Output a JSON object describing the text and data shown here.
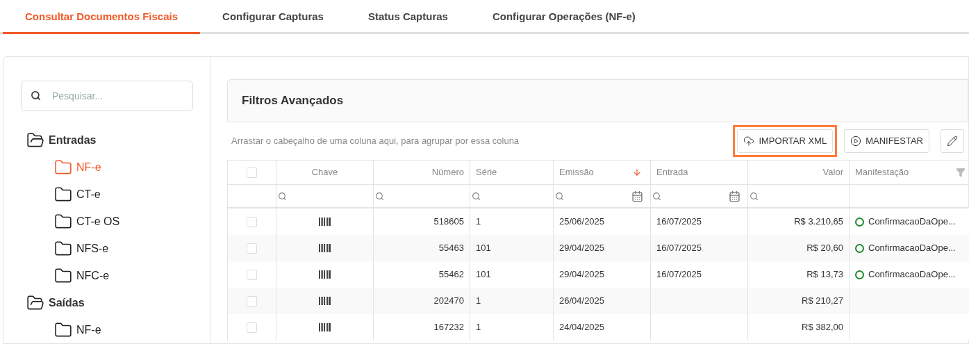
{
  "tabs": [
    {
      "label": "Consultar Documentos Fiscais",
      "selected": true
    },
    {
      "label": "Configurar Capturas",
      "selected": false
    },
    {
      "label": "Status Capturas",
      "selected": false
    },
    {
      "label": "Configurar Operações (NF-e)",
      "selected": false
    }
  ],
  "sidebar": {
    "search": {
      "placeholder": "Pesquisar..."
    },
    "tree": [
      {
        "label": "Entradas",
        "expanded": true,
        "children": [
          {
            "label": "NF-e",
            "selected": true
          },
          {
            "label": "CT-e",
            "selected": false
          },
          {
            "label": "CT-e OS",
            "selected": false
          },
          {
            "label": "NFS-e",
            "selected": false
          },
          {
            "label": "NFC-e",
            "selected": false
          }
        ]
      },
      {
        "label": "Saídas",
        "expanded": true,
        "children": [
          {
            "label": "NF-e",
            "selected": false
          }
        ]
      }
    ]
  },
  "filters_panel": {
    "title": "Filtros Avançados"
  },
  "group_hint": "Arrastar o cabeçalho de uma coluna aqui, para agrupar por essa coluna",
  "toolbar": [
    {
      "kind": "upload",
      "label": "IMPORTAR XML",
      "highlighted": true
    },
    {
      "kind": "play",
      "label": "MANIFESTAR",
      "highlighted": false
    },
    {
      "kind": "edit",
      "highlighted": false
    }
  ],
  "table": {
    "all_checked": false,
    "columns": [
      {
        "label": "Chave",
        "search_filter": true,
        "date_picker": false,
        "sorted_descending": false,
        "filter_icon": false
      },
      {
        "label": "Número",
        "search_filter": true,
        "date_picker": false,
        "sorted_descending": false,
        "filter_icon": false
      },
      {
        "label": "Série",
        "search_filter": true,
        "date_picker": false,
        "sorted_descending": false,
        "filter_icon": false
      },
      {
        "label": "Emissão",
        "search_filter": true,
        "date_picker": true,
        "sorted_descending": true,
        "filter_icon": false
      },
      {
        "label": "Entrada",
        "search_filter": true,
        "date_picker": true,
        "sorted_descending": false,
        "filter_icon": false
      },
      {
        "label": "Valor",
        "search_filter": true,
        "date_picker": false,
        "sorted_descending": false,
        "filter_icon": false
      },
      {
        "label": "Manifestação",
        "search_filter": false,
        "date_picker": false,
        "sorted_descending": false,
        "filter_icon": true
      }
    ],
    "rows": [
      {
        "checked": false,
        "numero": "518605",
        "serie": "1",
        "emissao": "25/06/2025",
        "entrada": "16/07/2025",
        "valor": "R$ 3.210,65",
        "manifestacao": "ConfirmacaoDaOpe..."
      },
      {
        "checked": false,
        "numero": "55463",
        "serie": "101",
        "emissao": "29/04/2025",
        "entrada": "16/07/2025",
        "valor": "R$ 20,60",
        "manifestacao": "ConfirmacaoDaOpe..."
      },
      {
        "checked": false,
        "numero": "55462",
        "serie": "101",
        "emissao": "29/04/2025",
        "entrada": "16/07/2025",
        "valor": "R$ 13,73",
        "manifestacao": "ConfirmacaoDaOpe..."
      },
      {
        "checked": false,
        "numero": "202470",
        "serie": "1",
        "emissao": "26/04/2025",
        "valor": "R$ 210,27"
      },
      {
        "checked": false,
        "numero": "167232",
        "serie": "1",
        "emissao": "24/04/2025",
        "valor": "R$ 382,00"
      }
    ]
  }
}
